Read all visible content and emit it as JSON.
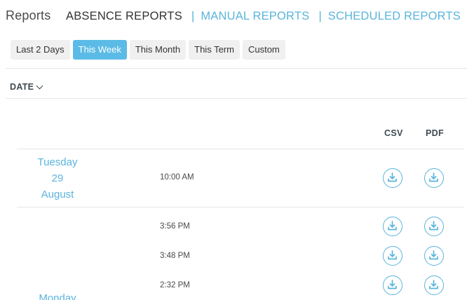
{
  "header": {
    "title": "Reports",
    "nav": [
      {
        "label": "ABSENCE REPORTS",
        "active": true
      },
      {
        "label": "MANUAL REPORTS",
        "active": false
      },
      {
        "label": "SCHEDULED REPORTS",
        "active": false
      }
    ],
    "separator": "|"
  },
  "filters": [
    {
      "label": "Last 2 Days",
      "selected": false
    },
    {
      "label": "This Week",
      "selected": true
    },
    {
      "label": "This Month",
      "selected": false
    },
    {
      "label": "This Term",
      "selected": false
    },
    {
      "label": "Custom",
      "selected": false
    }
  ],
  "table": {
    "sort_label": "DATE",
    "columns": {
      "csv": "CSV",
      "pdf": "PDF"
    },
    "groups": [
      {
        "date": {
          "weekday": "Tuesday",
          "day": "29",
          "month": "August"
        },
        "rows": [
          {
            "time": "10:00 AM"
          }
        ]
      },
      {
        "date": {
          "weekday": "Monday",
          "day": "",
          "month": ""
        },
        "rows": [
          {
            "time": "3:56 PM"
          },
          {
            "time": "3:48 PM"
          },
          {
            "time": "2:32 PM"
          }
        ]
      }
    ]
  },
  "colors": {
    "accent": "#5ab4dc",
    "selected_tab": "#5bbbe6",
    "tab_bg": "#f0f0f0",
    "header_text": "#3d4a52"
  },
  "icons": {
    "download": "download-icon",
    "sort": "chevron-down-icon"
  }
}
